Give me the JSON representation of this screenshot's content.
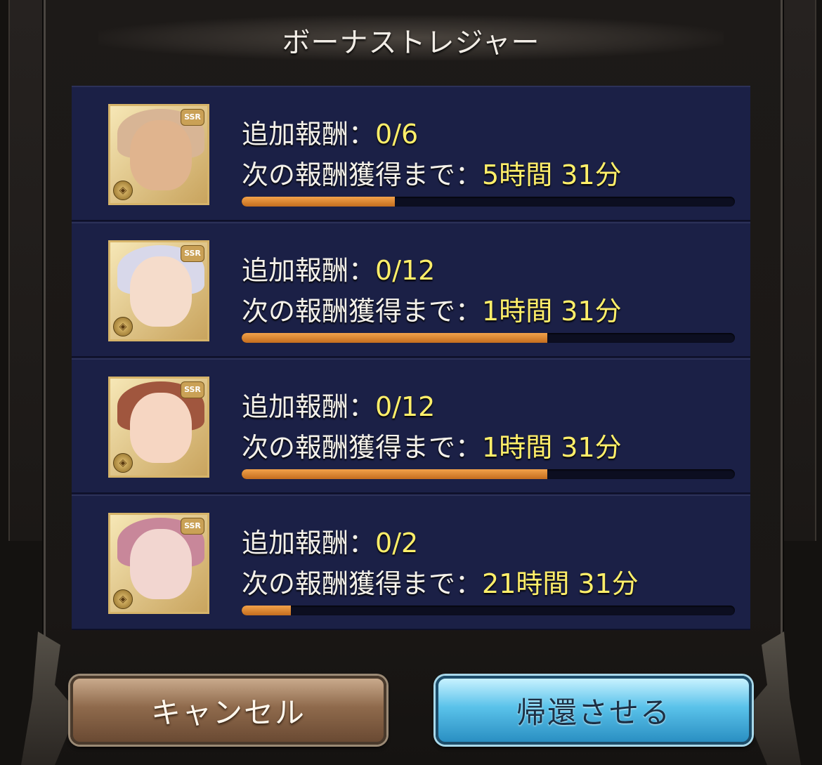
{
  "dialog": {
    "title": "ボーナストレジャー",
    "reward_label": "追加報酬：",
    "next_label": "次の報酬獲得まで：",
    "items": [
      {
        "reward": "0/6",
        "time": "5時間 31分",
        "progress_percent": 31,
        "hair": "#d8b595",
        "skin": "#e0b48e"
      },
      {
        "reward": "0/12",
        "time": "1時間 31分",
        "progress_percent": 62,
        "hair": "#d8d8ea",
        "skin": "#f5dccb"
      },
      {
        "reward": "0/12",
        "time": "1時間 31分",
        "progress_percent": 62,
        "hair": "#a0563e",
        "skin": "#f6d6c2"
      },
      {
        "reward": "0/2",
        "time": "21時間 31分",
        "progress_percent": 10,
        "hair": "#c8879a",
        "skin": "#f2d6d0"
      }
    ]
  },
  "buttons": {
    "cancel": "キャンセル",
    "return": "帰還させる"
  }
}
